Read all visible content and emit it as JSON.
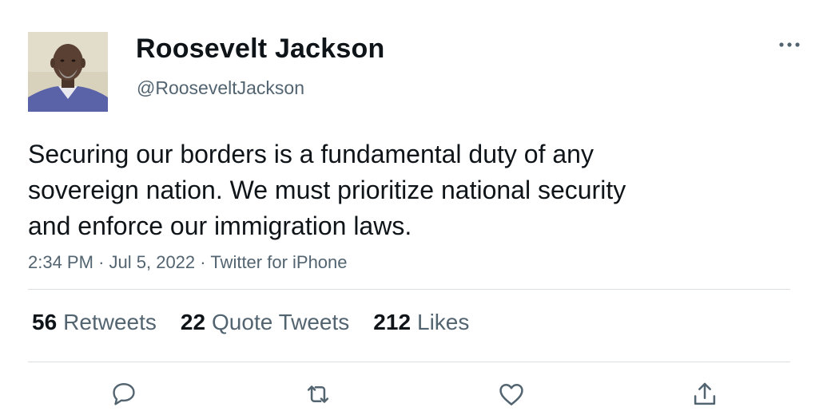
{
  "author": {
    "display_name": "Roosevelt Jackson",
    "handle": "@RooseveltJackson",
    "avatar_icon": "profile-photo"
  },
  "tweet": {
    "text_lines": [
      "Securing our borders is a fundamental duty of any",
      "sovereign nation. We must prioritize national security",
      "and enforce our immigration laws."
    ],
    "time": "2:34 PM",
    "separator": "·",
    "date": "Jul 5, 2022",
    "source": "Twitter for iPhone"
  },
  "stats": {
    "retweets": {
      "count": "56",
      "label": "Retweets"
    },
    "quote_tweets": {
      "count": "22",
      "label": "Quote Tweets"
    },
    "likes": {
      "count": "212",
      "label": "Likes"
    }
  },
  "actions": [
    "reply-icon",
    "retweet-icon",
    "like-icon",
    "share-icon"
  ],
  "colors": {
    "text_primary": "#0f1419",
    "text_secondary": "#536471",
    "divider": "#dadfe3",
    "icon": "#536471"
  }
}
